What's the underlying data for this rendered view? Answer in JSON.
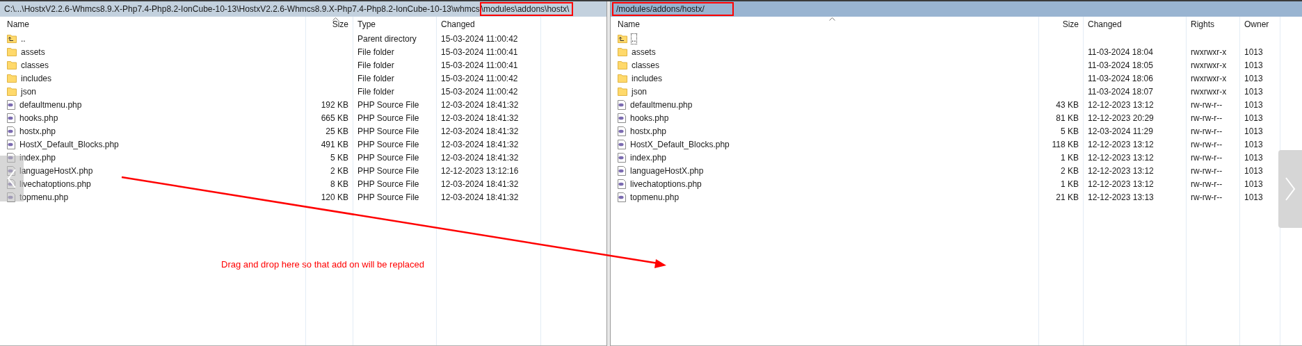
{
  "local_pane": {
    "path": {
      "text": "C:\\...\\HostxV2.2.6-Whmcs8.9.X-Php7.4-Php8.2-IonCube-10-13\\HostxV2.2.6-Whmcs8.9.X-Php7.4-Php8.2-IonCube-10-13\\whmcs",
      "highlighted": "\\modules\\addons\\hostx\\"
    },
    "columns": [
      "Name",
      "Size",
      "Type",
      "Changed"
    ],
    "rows": [
      {
        "kind": "parent",
        "name": "..",
        "type": "Parent directory",
        "changed": "15-03-2024 11:00:42"
      },
      {
        "kind": "folder",
        "name": "assets",
        "type": "File folder",
        "changed": "15-03-2024 11:00:41"
      },
      {
        "kind": "folder",
        "name": "classes",
        "type": "File folder",
        "changed": "15-03-2024 11:00:41"
      },
      {
        "kind": "folder",
        "name": "includes",
        "type": "File folder",
        "changed": "15-03-2024 11:00:42"
      },
      {
        "kind": "folder",
        "name": "json",
        "type": "File folder",
        "changed": "15-03-2024 11:00:42"
      },
      {
        "kind": "php",
        "name": "defaultmenu.php",
        "size": "192 KB",
        "type": "PHP Source File",
        "changed": "12-03-2024 18:41:32"
      },
      {
        "kind": "php",
        "name": "hooks.php",
        "size": "665 KB",
        "type": "PHP Source File",
        "changed": "12-03-2024 18:41:32"
      },
      {
        "kind": "php",
        "name": "hostx.php",
        "size": "25 KB",
        "type": "PHP Source File",
        "changed": "12-03-2024 18:41:32"
      },
      {
        "kind": "php",
        "name": "HostX_Default_Blocks.php",
        "size": "491 KB",
        "type": "PHP Source File",
        "changed": "12-03-2024 18:41:32"
      },
      {
        "kind": "php",
        "name": "index.php",
        "size": "5 KB",
        "type": "PHP Source File",
        "changed": "12-03-2024 18:41:32"
      },
      {
        "kind": "php",
        "name": "languageHostX.php",
        "size": "2 KB",
        "type": "PHP Source File",
        "changed": "12-12-2023 13:12:16"
      },
      {
        "kind": "php",
        "name": "livechatoptions.php",
        "size": "8 KB",
        "type": "PHP Source File",
        "changed": "12-03-2024 18:41:32"
      },
      {
        "kind": "php",
        "name": "topmenu.php",
        "size": "120 KB",
        "type": "PHP Source File",
        "changed": "12-03-2024 18:41:32"
      }
    ]
  },
  "remote_pane": {
    "path": {
      "highlighted": "/modules/addons/hostx/"
    },
    "columns": [
      "Name",
      "Size",
      "Changed",
      "Rights",
      "Owner"
    ],
    "rows": [
      {
        "kind": "parent",
        "name": "..",
        "focused": true
      },
      {
        "kind": "folder",
        "name": "assets",
        "changed": "11-03-2024 18:04",
        "rights": "rwxrwxr-x",
        "owner": "1013",
        "focused": false
      },
      {
        "kind": "folder",
        "name": "classes",
        "changed": "11-03-2024 18:05",
        "rights": "rwxrwxr-x",
        "owner": "1013",
        "focused": false
      },
      {
        "kind": "folder",
        "name": "includes",
        "changed": "11-03-2024 18:06",
        "rights": "rwxrwxr-x",
        "owner": "1013",
        "focused": false
      },
      {
        "kind": "folder",
        "name": "json",
        "changed": "11-03-2024 18:07",
        "rights": "rwxrwxr-x",
        "owner": "1013",
        "focused": false
      },
      {
        "kind": "php",
        "name": "defaultmenu.php",
        "size": "43 KB",
        "changed": "12-12-2023 13:12",
        "rights": "rw-rw-r--",
        "owner": "1013",
        "focused": false
      },
      {
        "kind": "php",
        "name": "hooks.php",
        "size": "81 KB",
        "changed": "12-12-2023 20:29",
        "rights": "rw-rw-r--",
        "owner": "1013",
        "focused": false
      },
      {
        "kind": "php",
        "name": "hostx.php",
        "size": "5 KB",
        "changed": "12-03-2024 11:29",
        "rights": "rw-rw-r--",
        "owner": "1013",
        "focused": false
      },
      {
        "kind": "php",
        "name": "HostX_Default_Blocks.php",
        "size": "118 KB",
        "changed": "12-12-2023 13:12",
        "rights": "rw-rw-r--",
        "owner": "1013",
        "focused": false
      },
      {
        "kind": "php",
        "name": "index.php",
        "size": "1 KB",
        "changed": "12-12-2023 13:12",
        "rights": "rw-rw-r--",
        "owner": "1013",
        "focused": false
      },
      {
        "kind": "php",
        "name": "languageHostX.php",
        "size": "2 KB",
        "changed": "12-12-2023 13:12",
        "rights": "rw-rw-r--",
        "owner": "1013",
        "focused": false
      },
      {
        "kind": "php",
        "name": "livechatoptions.php",
        "size": "1 KB",
        "changed": "12-12-2023 13:12",
        "rights": "rw-rw-r--",
        "owner": "1013",
        "focused": false
      },
      {
        "kind": "php",
        "name": "topmenu.php",
        "size": "21 KB",
        "changed": "12-12-2023 13:13",
        "rights": "rw-rw-r--",
        "owner": "1013",
        "focused": false
      }
    ]
  },
  "annotation": {
    "text": "Drag and drop here so that add on will be replaced"
  }
}
